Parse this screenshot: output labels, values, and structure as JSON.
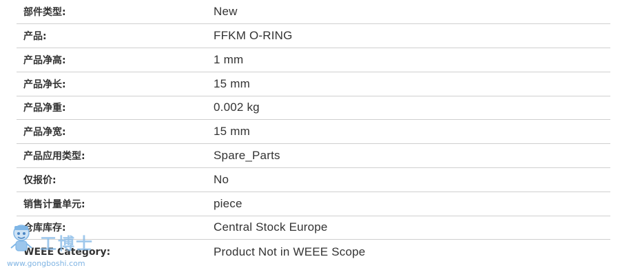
{
  "specs": [
    {
      "label": "部件类型:",
      "value": "New"
    },
    {
      "label": "产品:",
      "value": "FFKM O-RING"
    },
    {
      "label": "产品净高:",
      "value": "1 mm"
    },
    {
      "label": "产品净长:",
      "value": "15 mm"
    },
    {
      "label": "产品净重:",
      "value": "0.002 kg"
    },
    {
      "label": "产品净宽:",
      "value": "15 mm"
    },
    {
      "label": "产品应用类型:",
      "value": "Spare_Parts"
    },
    {
      "label": "仅报价:",
      "value": "No"
    },
    {
      "label": "销售计量单元:",
      "value": "piece"
    },
    {
      "label": "仓库库存:",
      "value": "Central Stock Europe"
    },
    {
      "label": "WEEE Category:",
      "value": "Product Not in WEEE Scope"
    }
  ],
  "watermark": {
    "brand": "工博士",
    "url": "www.gongboshi.com",
    "icon": "robot-mascot-icon"
  },
  "colors": {
    "divider": "#cfcfcf",
    "text": "#333333",
    "watermark": "#7fb6e6"
  }
}
